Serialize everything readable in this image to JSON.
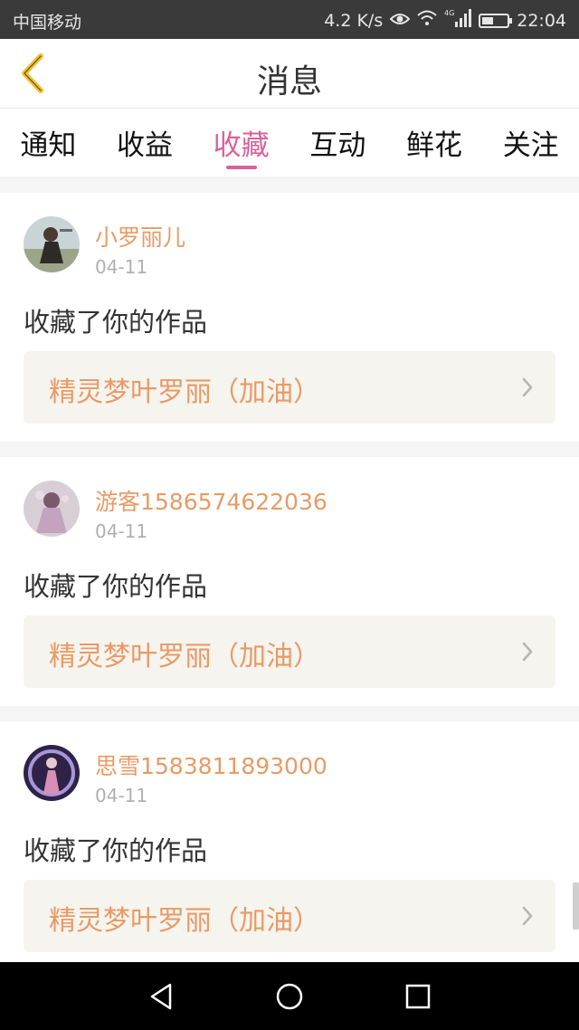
{
  "status_bar": {
    "carrier": "中国移动",
    "speed": "4.2 K/s",
    "network": "4G",
    "time": "22:04",
    "battery_level": 0.45
  },
  "header": {
    "title": "消息",
    "back_icon": "chevron-left-icon"
  },
  "tabs": [
    {
      "label": "通知",
      "active": false
    },
    {
      "label": "收益",
      "active": false
    },
    {
      "label": "收藏",
      "active": true
    },
    {
      "label": "互动",
      "active": false
    },
    {
      "label": "鲜花",
      "active": false
    },
    {
      "label": "关注",
      "active": false
    }
  ],
  "messages": [
    {
      "user": "小罗丽儿",
      "date": "04-11",
      "action": "收藏了你的作品",
      "work": "精灵梦叶罗丽（加油）"
    },
    {
      "user": "游客1586574622036",
      "date": "04-11",
      "action": "收藏了你的作品",
      "work": "精灵梦叶罗丽（加油）"
    },
    {
      "user": "思雪1583811893000",
      "date": "04-11",
      "action": "收藏了你的作品",
      "work": "精灵梦叶罗丽（加油）"
    }
  ],
  "colors": {
    "accent": "#d9619b",
    "name": "#e99a66",
    "back_icon": "#f0c230"
  }
}
